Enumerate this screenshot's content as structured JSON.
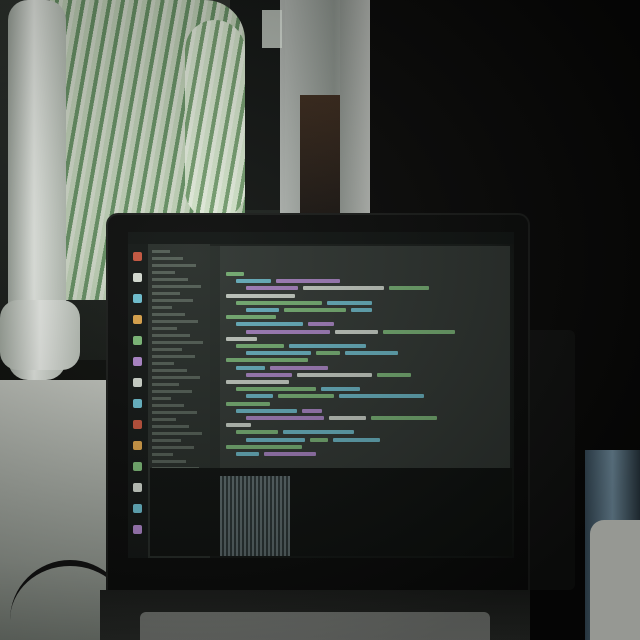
{
  "scene": {
    "description_type": "photo",
    "screen": {
      "topbar_text": "",
      "tab_title": ""
    },
    "colors": {
      "shirt_stripe": "#6d9b6a",
      "screen_bg": "#2d332f",
      "code_green": "#7fbf7a",
      "code_cyan": "#6ec3d4",
      "code_purple": "#b48ad1",
      "code_white": "#d9e0d6"
    }
  }
}
